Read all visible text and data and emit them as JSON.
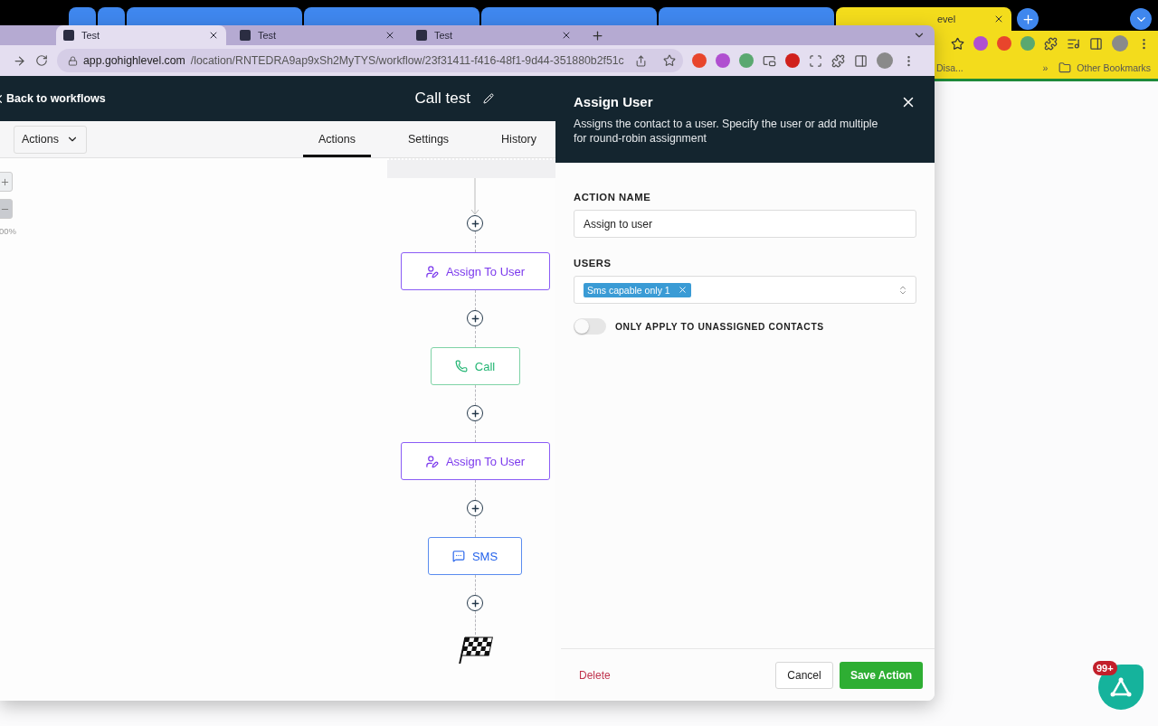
{
  "back_window": {
    "tabs": [
      {
        "pinned": true,
        "selected": false,
        "color": "#3f87ee"
      },
      {
        "pinned": true,
        "selected": false,
        "color": "#3f87ee"
      },
      {
        "pinned": false,
        "selected": false,
        "color": "#3f87ee"
      },
      {
        "pinned": false,
        "selected": false,
        "color": "#3f87ee"
      },
      {
        "pinned": false,
        "selected": false,
        "color": "#3f87ee"
      },
      {
        "pinned": false,
        "selected": false,
        "color": "#3f87ee"
      },
      {
        "pinned": false,
        "selected": true,
        "color": "#f3dc1c",
        "title": "evel"
      }
    ],
    "bookmarks": [
      {
        "kind": "page",
        "label": "Disa..."
      },
      {
        "kind": "overflow",
        "label": "»"
      },
      {
        "kind": "folder",
        "label": "Other Bookmarks"
      }
    ]
  },
  "browser": {
    "tabs": [
      {
        "title": "Test",
        "selected": true
      },
      {
        "title": "Test",
        "selected": false
      },
      {
        "title": "Test",
        "selected": false
      }
    ],
    "url": {
      "host": "app.gohighlevel.com",
      "path": "/location/RNTEDRA9ap9xSh2MyTYS/workflow/23f31411-f416-48f1-9d44-351880b2f51c"
    }
  },
  "app": {
    "back_link": "Back to workflows",
    "title": "Call test",
    "actions_menu": "Actions",
    "tabs": [
      {
        "label": "Actions",
        "selected": true
      },
      {
        "label": "Settings",
        "selected": false
      },
      {
        "label": "History",
        "selected": false
      }
    ],
    "zoom_level": "00%",
    "nodes": [
      {
        "kind": "assign_user",
        "label": "Assign To User"
      },
      {
        "kind": "call",
        "label": "Call"
      },
      {
        "kind": "assign_user",
        "label": "Assign To User"
      },
      {
        "kind": "sms",
        "label": "SMS"
      }
    ]
  },
  "panel": {
    "title": "Assign User",
    "description": "Assigns the contact to a user. Specify the user or add multiple for round-robin assignment",
    "action_name": {
      "label": "ACTION NAME",
      "value": "Assign to user"
    },
    "users": {
      "label": "USERS",
      "tags": [
        "Sms capable only 1"
      ]
    },
    "toggle": {
      "label": "ONLY APPLY TO UNASSIGNED CONTACTS",
      "on": false
    },
    "buttons": {
      "delete": "Delete",
      "cancel": "Cancel",
      "save": "Save Action"
    }
  },
  "fab": {
    "badge": "99+"
  }
}
